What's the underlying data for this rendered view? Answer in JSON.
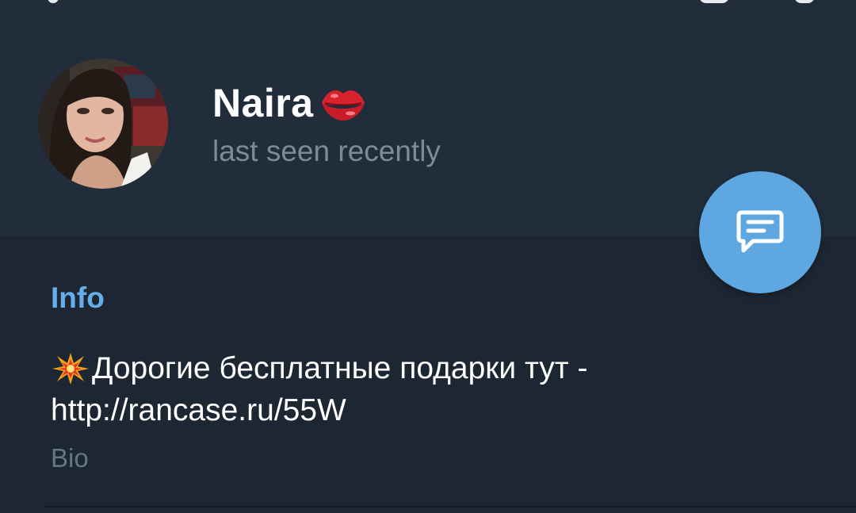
{
  "profile": {
    "name": "Naira",
    "name_emoji": "lips-emoji",
    "status": "last seen recently",
    "avatar": "user-photo"
  },
  "fab": {
    "icon": "message-icon"
  },
  "info": {
    "section_title": "Info",
    "bio_emoji": "collision-emoji",
    "bio_line_1": "Дорогие бесплатные подарки тут -",
    "bio_line_2": "http://rancase.ru/55W",
    "bio_label": "Bio"
  },
  "colors": {
    "header_bg": "#212d3b",
    "body_bg": "#1d2733",
    "accent": "#65aee9",
    "fab_bg": "#5ea7e0",
    "secondary_text": "#7d8b99"
  }
}
